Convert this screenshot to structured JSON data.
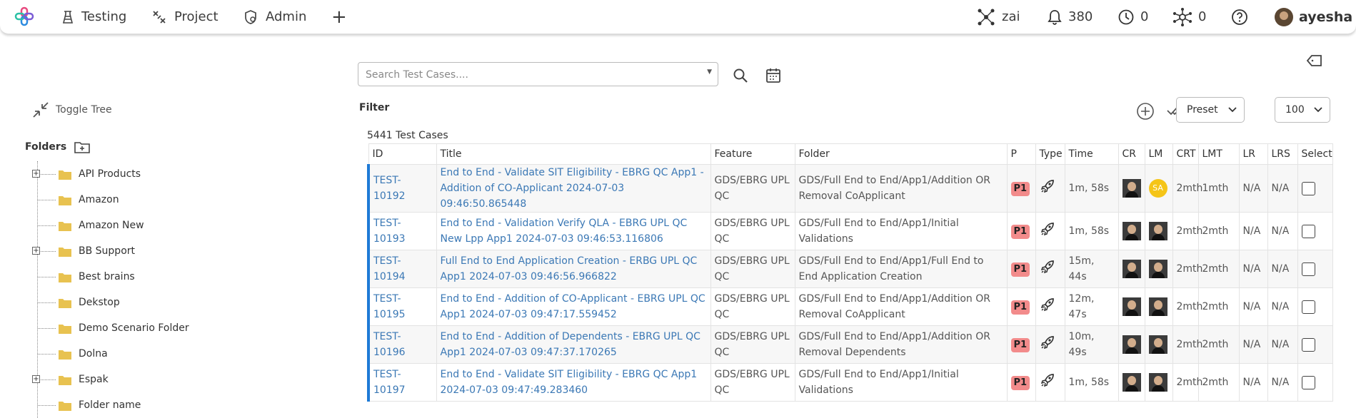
{
  "nav": {
    "testing": "Testing",
    "project": "Project",
    "admin": "Admin",
    "add_symbol": "+"
  },
  "header_right": {
    "zai": "zai",
    "notifications": "380",
    "clock_count": "0",
    "network_count": "0",
    "username": "ayesha"
  },
  "sidebar": {
    "toggle_tree": "Toggle Tree",
    "folders_title": "Folders",
    "items": [
      {
        "label": "API Products",
        "expandable": true
      },
      {
        "label": "Amazon",
        "expandable": false
      },
      {
        "label": "Amazon New",
        "expandable": false
      },
      {
        "label": "BB Support",
        "expandable": true
      },
      {
        "label": "Best brains",
        "expandable": false
      },
      {
        "label": "Dekstop",
        "expandable": false
      },
      {
        "label": "Demo Scenario Folder",
        "expandable": false
      },
      {
        "label": "Dolna",
        "expandable": false
      },
      {
        "label": "Espak",
        "expandable": true
      },
      {
        "label": "Folder name",
        "expandable": false
      }
    ]
  },
  "search": {
    "placeholder": "Search Test Cases...."
  },
  "toolbar": {
    "filter": "Filter",
    "preset": "Preset",
    "page_size": "100",
    "count_text": "5441 Test Cases"
  },
  "table": {
    "headers": [
      "ID",
      "Title",
      "Feature",
      "Folder",
      "P",
      "Type",
      "Time",
      "CR",
      "LM",
      "CRT",
      "LMT",
      "LR",
      "LRS",
      "Select"
    ],
    "rows": [
      {
        "id": "TEST-10192",
        "title": "End to End - Validate SIT Eligibility - EBRG QC App1 - Addition of CO-Applicant 2024-07-03 09:46:50.865448",
        "feature": "GDS/EBRG UPL QC",
        "folder": "GDS/Full End to End/App1/Addition OR Removal CoApplicant",
        "p": "P1",
        "time": "1m, 58s",
        "lm": "SA",
        "crt": "2mth",
        "lmt": "1mth",
        "lr": "N/A",
        "lrs": "N/A"
      },
      {
        "id": "TEST-10193",
        "title": "End to End - Validation Verify QLA - EBRG UPL QC New Lpp App1 2024-07-03 09:46:53.116806",
        "feature": "GDS/EBRG UPL QC",
        "folder": "GDS/Full End to End/App1/Initial Validations",
        "p": "P1",
        "time": "1m, 58s",
        "lm": "",
        "crt": "2mth",
        "lmt": "2mth",
        "lr": "N/A",
        "lrs": "N/A"
      },
      {
        "id": "TEST-10194",
        "title": "Full End to End Application Creation - ERBG UPL QC App1 2024-07-03 09:46:56.966822",
        "feature": "GDS/EBRG UPL QC",
        "folder": "GDS/Full End to End/App1/Full End to End Application Creation",
        "p": "P1",
        "time": "15m, 44s",
        "lm": "",
        "crt": "2mth",
        "lmt": "2mth",
        "lr": "N/A",
        "lrs": "N/A"
      },
      {
        "id": "TEST-10195",
        "title": "End to End - Addition of CO-Applicant - EBRG UPL QC App1 2024-07-03 09:47:17.559452",
        "feature": "GDS/EBRG UPL QC",
        "folder": "GDS/Full End to End/App1/Addition OR Removal CoApplicant",
        "p": "P1",
        "time": "12m, 47s",
        "lm": "",
        "crt": "2mth",
        "lmt": "2mth",
        "lr": "N/A",
        "lrs": "N/A"
      },
      {
        "id": "TEST-10196",
        "title": "End to End - Addition of Dependents - EBRG UPL QC App1 2024-07-03 09:47:37.170265",
        "feature": "GDS/EBRG UPL QC",
        "folder": "GDS/Full End to End/App1/Addition OR Removal Dependents",
        "p": "P1",
        "time": "10m, 49s",
        "lm": "",
        "crt": "2mth",
        "lmt": "2mth",
        "lr": "N/A",
        "lrs": "N/A"
      },
      {
        "id": "TEST-10197",
        "title": "End to End - Validate SIT Eligibility - EBRG QC App1 2024-07-03 09:47:49.283460",
        "feature": "GDS/EBRG UPL QC",
        "folder": "GDS/Full End to End/App1/Initial Validations",
        "p": "P1",
        "time": "1m, 58s",
        "lm": "",
        "crt": "2mth",
        "lmt": "2mth",
        "lr": "N/A",
        "lrs": "N/A"
      }
    ]
  },
  "colors": {
    "accent_blue": "#1e7ad6",
    "link_blue": "#3b78b5",
    "priority_badge": "#f28b8b",
    "folder_yellow": "#e8c250",
    "avatar_yellow": "#f5c518"
  },
  "icons": {
    "logo": "app-logo-icon",
    "testing": "flask-icon",
    "project": "project-tools-icon",
    "admin": "admin-gear-icon",
    "notifications": "bell-icon",
    "clock": "clock-icon",
    "network": "network-icon",
    "help": "question-icon",
    "type": "rocket-icon"
  }
}
